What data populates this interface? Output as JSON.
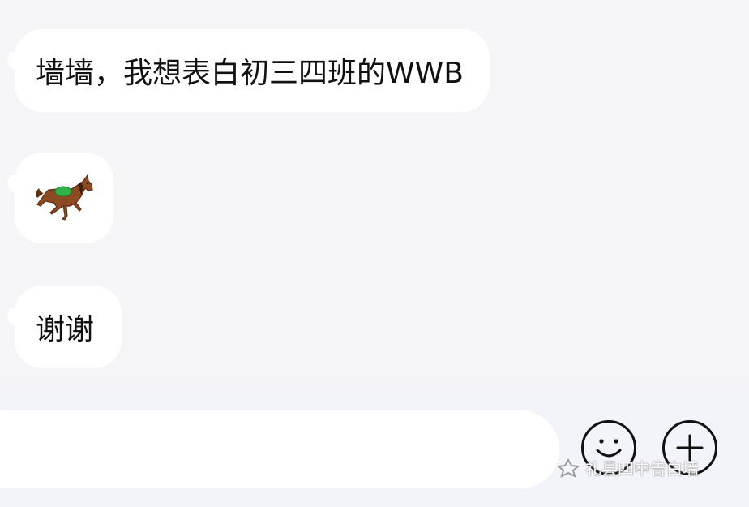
{
  "messages": [
    {
      "type": "text",
      "text": "墙墙，我想表白初三四班的WWB"
    },
    {
      "type": "sticker",
      "icon": "horse-icon"
    },
    {
      "type": "text",
      "text": "谢谢"
    }
  ],
  "input": {
    "value": "",
    "placeholder": ""
  },
  "toolbar": {
    "emoji_icon": "smiley-icon",
    "plus_icon": "plus-icon"
  },
  "watermark": {
    "text": "礼县四中告白墙"
  }
}
